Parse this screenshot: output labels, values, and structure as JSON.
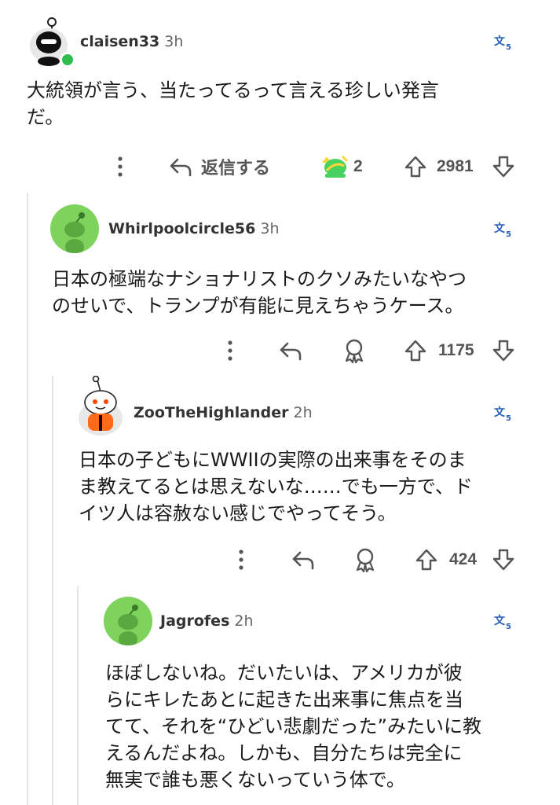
{
  "comments": [
    {
      "username": "claisen33",
      "time": "3h",
      "lines": [
        "大統領が言う、当たってるって言える珍しい発言",
        "だ。"
      ],
      "reply_label": "返信する",
      "award_count": "2",
      "votes": "2981"
    },
    {
      "username": "Whirlpoolcircle56",
      "time": "3h",
      "lines": [
        "日本の極端なナショナリストのクソみたいなやつ",
        "のせいで、トランプが有能に見えちゃうケース。"
      ],
      "votes": "1175"
    },
    {
      "username": "ZooTheHighlander",
      "time": "2h",
      "lines": [
        "日本の子どもにWWIIの実際の出来事をそのま",
        "ま教えてるとは思えないな……でも一方で、ド",
        "イツ人は容赦ない感じでやってそう。"
      ],
      "votes": "424"
    },
    {
      "username": "Jagrofes",
      "time": "2h",
      "lines": [
        "ほぼしないね。だいたいは、アメリカが彼",
        "らにキレたあとに起きた出来事に焦点を当",
        "てて、それを“ひどい悲劇だった”みたいに教",
        "えるんだよね。しかも、自分たちは完全に",
        "無実で誰も悪くないっていう体で。"
      ]
    }
  ],
  "colors": {
    "online": "#2fbe4e",
    "avatar_green": "#7dd35c",
    "award_green": "#46d160",
    "text": "#1a1a1b",
    "meta": "#666666"
  },
  "icons": [
    "more-vertical-icon",
    "reply-icon",
    "award-icon",
    "upvote-icon",
    "downvote-icon",
    "translate-icon"
  ]
}
